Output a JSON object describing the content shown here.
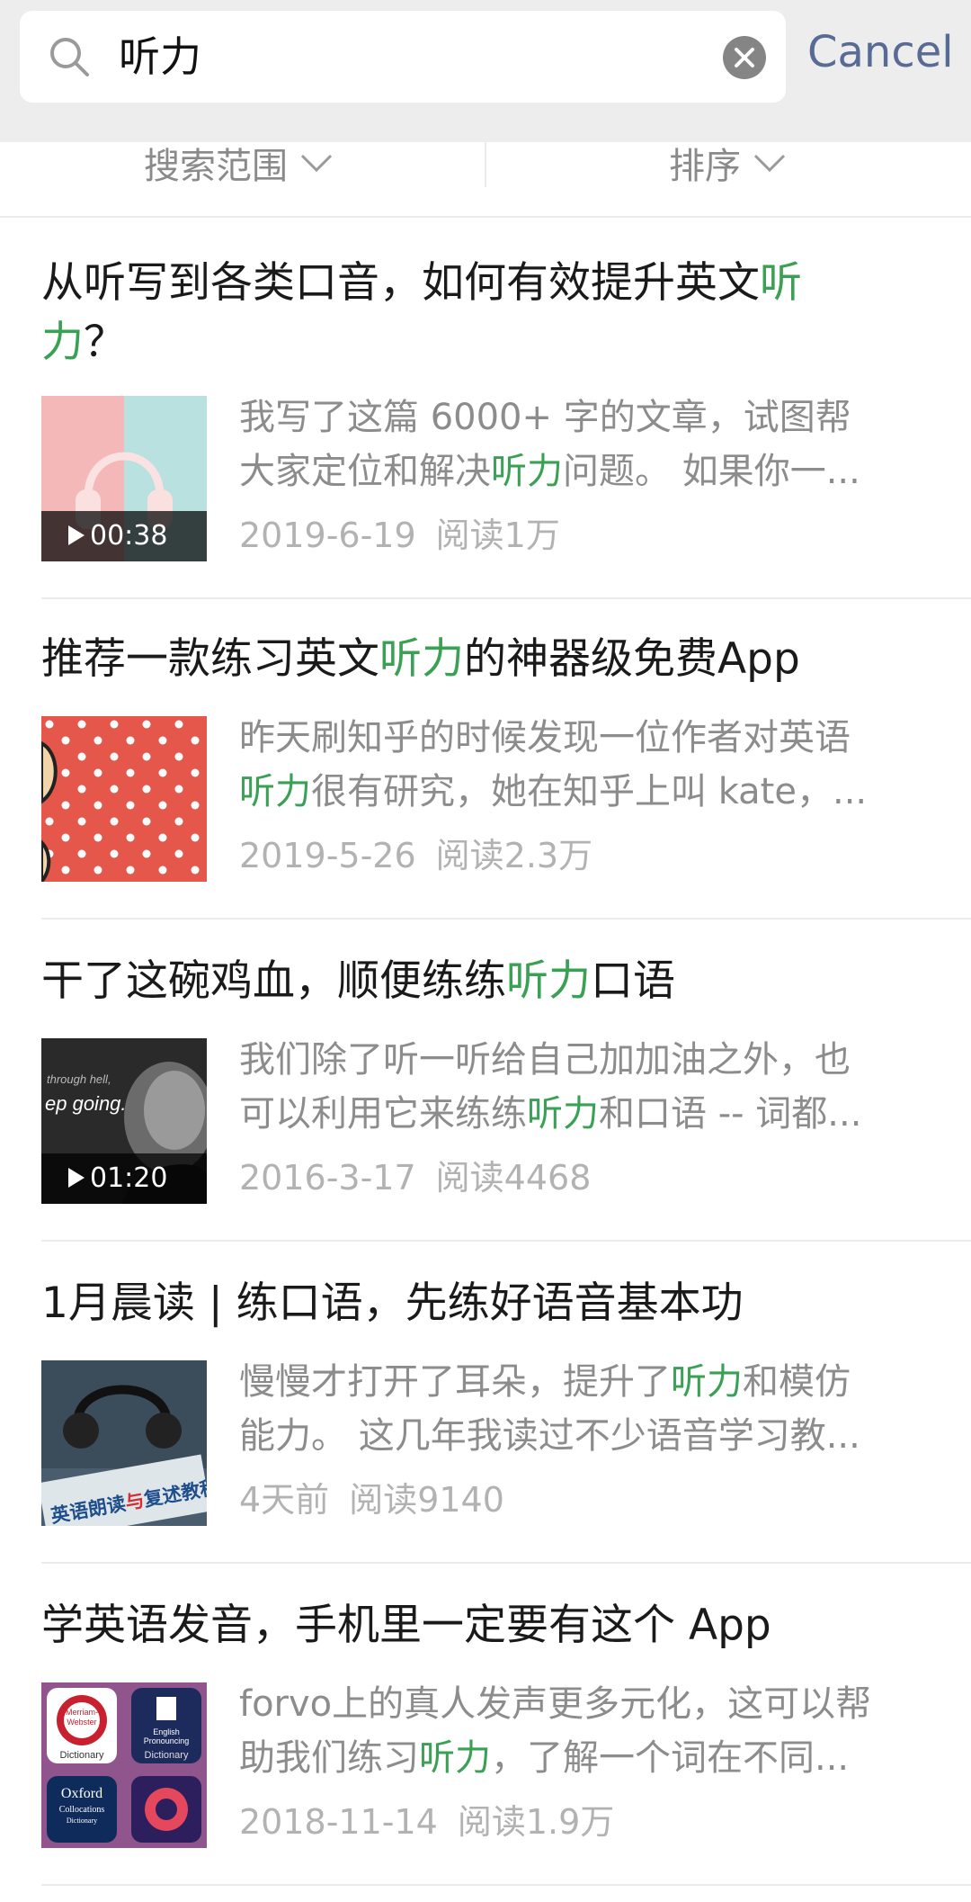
{
  "search": {
    "query": "听力",
    "cancel_label": "Cancel"
  },
  "filters": {
    "scope_label": "搜索范围",
    "sort_label": "排序"
  },
  "results": [
    {
      "title_parts": [
        "从听写到各类口音，如何有效提升英文",
        "听",
        "力",
        "？"
      ],
      "snippet_parts": [
        "我写了这篇 6000+ 字的文章，试图帮",
        "大家定位和解决",
        "听力",
        "问题。 如果你一..."
      ],
      "date": "2019-6-19",
      "reads": "阅读1万",
      "duration": "00:38",
      "thumb_icon": "headphones-image"
    },
    {
      "title_parts": [
        "推荐一款练习英文",
        "听力",
        "的神器级免费App"
      ],
      "snippet_parts": [
        "昨天刷知乎的时候发现一位作者对英语",
        "听力",
        "很有研究，她在知乎上叫 kate，..."
      ],
      "date": "2019-5-26",
      "reads": "阅读2.3万",
      "thumb_icon": "polka-dot-image"
    },
    {
      "title_parts": [
        "干了这碗鸡血，顺便练练",
        "听力",
        "口语"
      ],
      "snippet_parts": [
        "我们除了听一听给自己加加油之外，也",
        "可以利用它来练练",
        "听力",
        "和口语 -- 词都..."
      ],
      "date": "2016-3-17",
      "reads": "阅读4468",
      "duration": "01:20",
      "thumb_text": [
        "through hell,",
        "ep going."
      ],
      "thumb_icon": "portrait-image"
    },
    {
      "title_parts": [
        "1月晨读 | 练口语，先练好语音基本功"
      ],
      "snippet_parts": [
        "慢慢才打开了耳朵，提升了",
        "听力",
        "和模仿",
        "能力。 这几年我读过不少语音学习教..."
      ],
      "date": "4天前",
      "reads": "阅读9140",
      "thumb_text": [
        "英语朗读",
        "与",
        "复述教程"
      ],
      "thumb_icon": "book-headphones-image"
    },
    {
      "title_parts": [
        "学英语发音，手机里一定要有这个 App"
      ],
      "snippet_parts": [
        "forvo上的真人发声更多元化，这可以帮",
        "助我们练习",
        "听力",
        "，了解一个词在不同..."
      ],
      "date": "2018-11-14",
      "reads": "阅读1.9万",
      "thumb_text": [
        "Merriam-",
        "Webster",
        "Dictionary",
        "English",
        "Pronouncing",
        "Dictionary",
        "Oxford",
        "Collocations",
        "Dictionary"
      ],
      "thumb_icon": "app-icons-image"
    }
  ],
  "colors": {
    "highlight": "#3aa154",
    "cancel": "#576b95",
    "meta": "#b2b2b2",
    "snippet": "#8c8c8c"
  }
}
